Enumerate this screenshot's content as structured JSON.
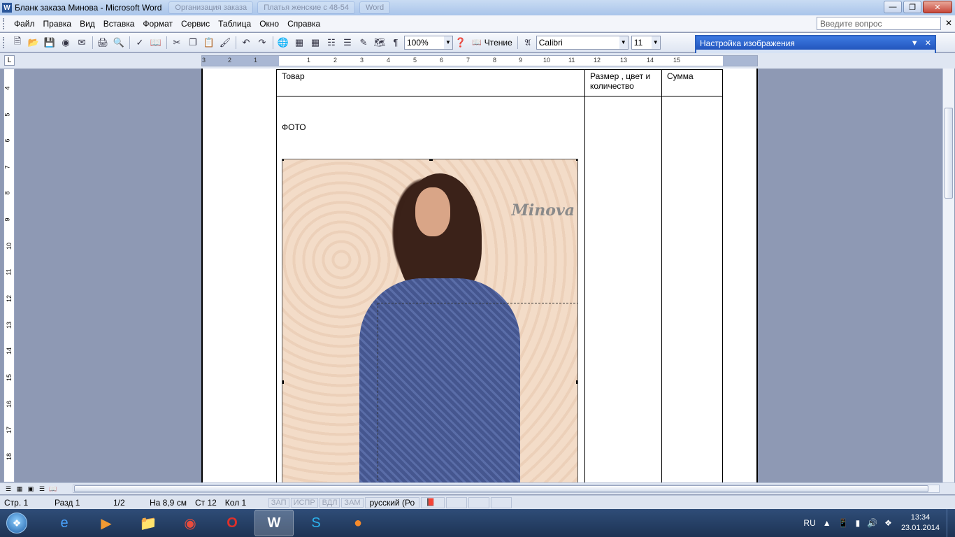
{
  "window": {
    "title": "Бланк заказа Минова - Microsoft Word",
    "background_tabs": [
      "Организация заказа",
      "Платья женские с 48-54",
      "Word"
    ]
  },
  "menu": {
    "items": [
      "Файл",
      "Правка",
      "Вид",
      "Вставка",
      "Формат",
      "Сервис",
      "Таблица",
      "Окно",
      "Справка"
    ],
    "ask_placeholder": "Введите вопрос"
  },
  "toolbar": {
    "zoom": "100%",
    "read_label": "Чтение",
    "font_name": "Calibri",
    "font_size": "11"
  },
  "picture_toolbar": {
    "title": "Настройка изображения"
  },
  "ruler": {
    "h_numbers": [
      "3",
      "2",
      "1",
      "1",
      "2",
      "3",
      "4",
      "5",
      "6",
      "7",
      "8",
      "9",
      "10",
      "11",
      "12",
      "13",
      "14",
      "15"
    ],
    "v_numbers": [
      "4",
      "5",
      "6",
      "7",
      "8",
      "9",
      "10",
      "11",
      "12",
      "13",
      "14",
      "15",
      "16",
      "17",
      "18"
    ]
  },
  "document": {
    "table": {
      "headers": [
        "Товар",
        "Размер , цвет и количество",
        "Сумма"
      ],
      "photo_label": "ФОТО"
    },
    "photo_logo": "Minova"
  },
  "status": {
    "page": "Стр. 1",
    "section": "Разд 1",
    "pages": "1/2",
    "position": "На 8,9 см",
    "line": "Ст  12",
    "column": "Кол  1",
    "modes": [
      "ЗАП",
      "ИСПР",
      "ВДЛ",
      "ЗАМ"
    ],
    "language": "русский (Ро"
  },
  "taskbar": {
    "language": "RU",
    "time": "13:34",
    "date": "23.01.2014"
  }
}
